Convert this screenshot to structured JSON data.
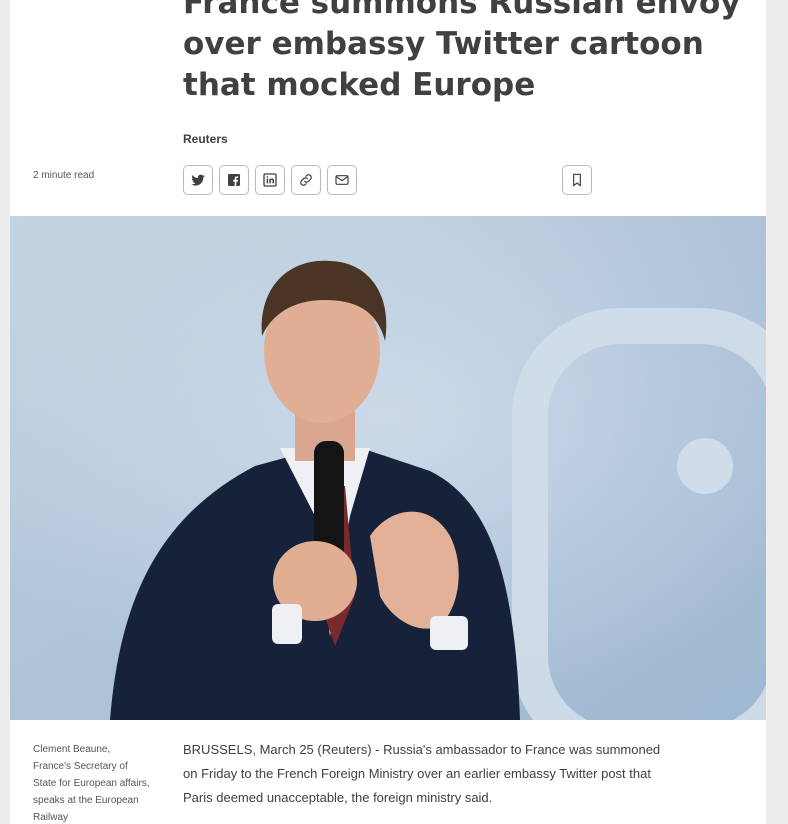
{
  "article": {
    "headline_lines": [
      "France summons Russian envoy",
      "over embassy Twitter cartoon",
      "that mocked Europe"
    ],
    "byline": "Reuters",
    "read_time": "2 minute read",
    "share_icons": [
      "twitter-icon",
      "facebook-icon",
      "linkedin-icon",
      "link-icon",
      "email-icon"
    ],
    "bookmark_icon": "bookmark-icon",
    "image_caption": "Clement Beaune, France's Secretary of State for European affairs, speaks at the European Railway",
    "lead_paragraph": "BRUSSELS, March 25 (Reuters) - Russia's ambassador to France was summoned on Friday to the French Foreign Ministry over an earlier embassy Twitter post that Paris deemed unacceptable, the foreign ministry said."
  },
  "colors": {
    "text": "#404040",
    "muted": "#555555",
    "border": "#b9b9b9",
    "background": "#ededed",
    "card": "#ffffff"
  }
}
